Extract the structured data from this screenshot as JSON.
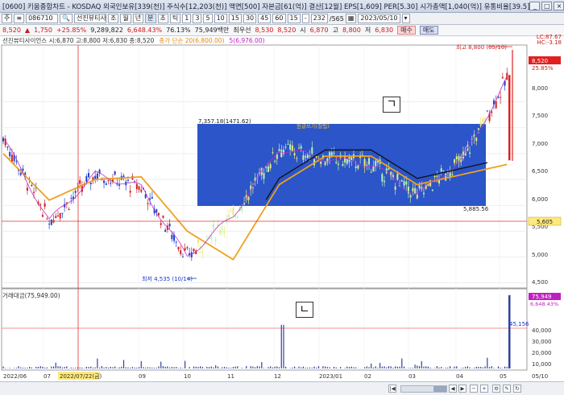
{
  "window": {
    "title": "[0600] 키움종합차트 - KOSDAQ 외국인보유[339(천)] 주식수[12,203(천)] 액면[500] 자본금[61(억)] 결산[12월] EPS[1,609] PER[5.30] 시가총액[1,040(억)] 유통비율[39.5]",
    "buttons": [
      "_",
      "□",
      "×"
    ]
  },
  "toolbar": {
    "labels": [
      "주",
      "≡"
    ],
    "stock_code": "086710",
    "stock_name": "선진뷰티사",
    "search_label": "조",
    "periods": [
      "월",
      "년",
      "분",
      "초",
      "틱"
    ],
    "intervals": [
      "1",
      "3",
      "5",
      "10",
      "15",
      "30",
      "45",
      "60",
      "15"
    ],
    "dash": "-",
    "count": "232",
    "count_total": "/565",
    "date": "2023/05/10"
  },
  "quote": {
    "price": "8,520",
    "change_arrow": "▲",
    "change": "1,750",
    "change_pct": "+25.85%",
    "volume": "9,289,822",
    "volume_pct": "6,648.43%",
    "volume_ratio": "76.13%",
    "amount": "75,949백만",
    "priority_label": "최우선",
    "bid": "8,530",
    "ask": "8,520",
    "low_label": "시",
    "low": "6,870",
    "high_label": "고",
    "high": "8,800",
    "close_label": "저",
    "close": "6,830",
    "buy": "매수",
    "sell": "매도"
  },
  "legend": {
    "price": "선진뷰티사이언스 시:6,870 고:8,800 저:6,830 종:8,520",
    "ma20": "종가 단순 20(6,800.00)",
    "ma5": "5(6,976.00)",
    "volume": "거래대금(75,949.00)"
  },
  "right_info": {
    "lc": "LC:87.67",
    "hc": "HC:-3.18"
  },
  "price_axis": {
    "ticks": [
      "8,000",
      "7,500",
      "7,000",
      "6,500",
      "6,000",
      "5,500",
      "5,000",
      "4,500"
    ],
    "current_price": "8,520",
    "current_pct": "25.85%",
    "line_price": "5,605"
  },
  "vol_axis": {
    "ticks": [
      "40,000",
      "30,000",
      "20,000",
      "10,000"
    ],
    "current": "75,949",
    "current_pct": "6,648.43%"
  },
  "x_axis": {
    "labels": [
      "2022/06",
      "07",
      "2022/07/22(금)",
      "09",
      "10",
      "11",
      "12",
      "2023/01",
      "02",
      "03",
      "04",
      "05",
      "05/10"
    ]
  },
  "annotations": {
    "high": "최고 8,800 (05/10)",
    "low": "최저 4,535 (10/14)",
    "box_top": "7,357.18(1471.62)",
    "box_bottom": "5,885.56",
    "box_inner": "원글쓰기(잘됨)",
    "vol_peak": "45,156"
  },
  "markers": {
    "top": "ㄱ",
    "bottom": "ㄴ"
  },
  "chart_data": {
    "type": "line",
    "ylim": [
      4400,
      9100
    ],
    "x": [
      "2022/06",
      "07",
      "08",
      "09",
      "10",
      "11",
      "12",
      "2023/01",
      "02",
      "03",
      "04",
      "05"
    ],
    "series": [
      {
        "name": "종가 단순 20",
        "values": [
          7000,
          6100,
          6500,
          6550,
          5500,
          4950,
          6400,
          6950,
          6950,
          6400,
          6600,
          6800
        ]
      },
      {
        "name": "5",
        "values": [
          7300,
          5700,
          6600,
          6350,
          5000,
          5800,
          7100,
          6900,
          6800,
          6200,
          6900,
          8520
        ]
      }
    ],
    "volume_ylim": [
      0,
      80000
    ],
    "volume_peak": 45156,
    "volume_current": 75949
  }
}
